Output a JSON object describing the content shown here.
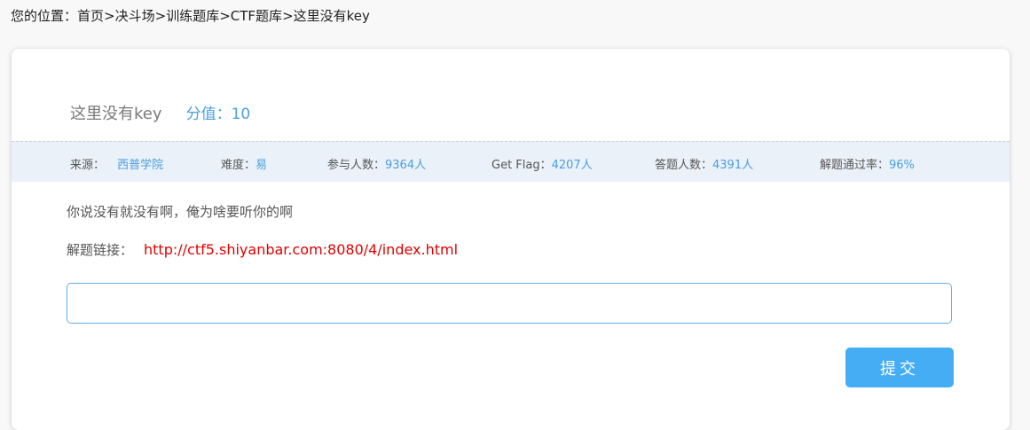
{
  "breadcrumb": {
    "prefix": "您的位置：",
    "items": [
      "首页",
      "决斗场",
      "训练题库",
      "CTF题库",
      "这里没有key"
    ],
    "separator": ">"
  },
  "challenge": {
    "title": "这里没有key",
    "score_label": "分值：",
    "score_value": "10"
  },
  "stats": {
    "source_label": "来源：",
    "source_value": "西普学院",
    "difficulty_label": "难度：",
    "difficulty_value": "易",
    "participants_label": "参与人数：",
    "participants_value": "9364人",
    "getflag_label": "Get Flag：",
    "getflag_value": "4207人",
    "answered_label": "答题人数：",
    "answered_value": "4391人",
    "passrate_label": "解题通过率：",
    "passrate_value": "96%"
  },
  "description": "你说没有就没有啊，俺为啥要听你的啊",
  "link": {
    "label": "解题链接：",
    "url": "http://ctf5.shiyanbar.com:8080/4/index.html"
  },
  "answer": {
    "value": "",
    "placeholder": ""
  },
  "submit_label": "提交",
  "colors": {
    "accent": "#45adf3",
    "link_red": "#e00000",
    "value_blue": "#4a9fe0",
    "stats_bg": "#eaf1f8"
  }
}
